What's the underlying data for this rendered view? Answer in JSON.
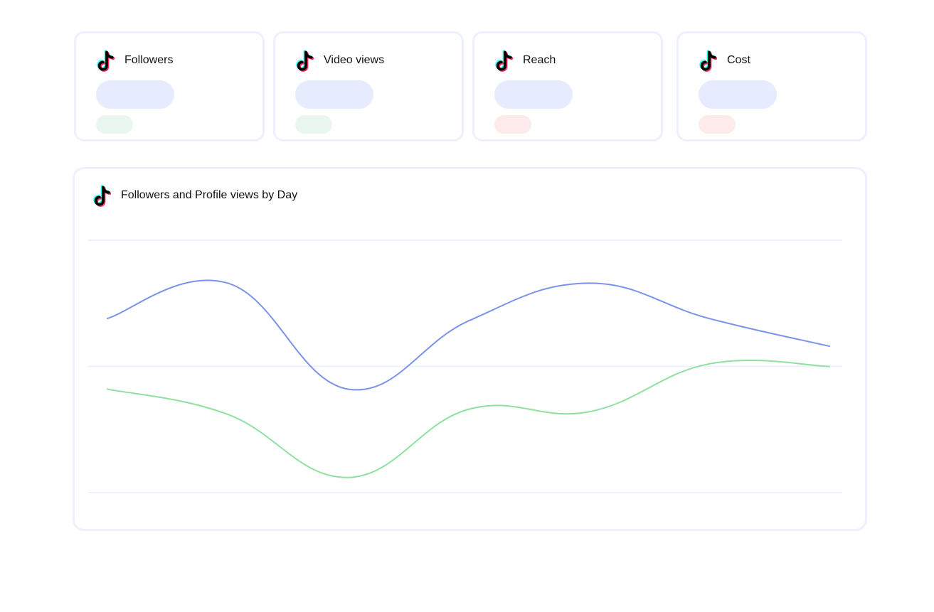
{
  "cards": [
    {
      "title": "Followers",
      "value_placeholder_color": "#e6ebfd",
      "delta_placeholder_color": "#eaf7ee",
      "delta_trend": "positive"
    },
    {
      "title": "Video views",
      "value_placeholder_color": "#e6ebfd",
      "delta_placeholder_color": "#eaf7ee",
      "delta_trend": "positive"
    },
    {
      "title": "Reach",
      "value_placeholder_color": "#e6ebfd",
      "delta_placeholder_color": "#fdeaea",
      "delta_trend": "negative"
    },
    {
      "title": "Cost",
      "value_placeholder_color": "#e6ebfd",
      "delta_placeholder_color": "#fdeaea",
      "delta_trend": "negative"
    }
  ],
  "icons": {
    "platform": "tiktok-icon"
  },
  "colors": {
    "card_border": "#edf0fd",
    "gridline": "#edf0fd",
    "tiktok_cyan": "#25f4ee",
    "tiktok_red": "#fe2c55",
    "tiktok_black": "#000000"
  },
  "chart_data": {
    "type": "line",
    "title": "Followers and Profile views by Day",
    "xlabel": "",
    "ylabel": "",
    "x": [
      1,
      2,
      3,
      4,
      5,
      6,
      7
    ],
    "ylim": [
      0,
      100
    ],
    "yticks": [
      0,
      50,
      100
    ],
    "grid": true,
    "legend": "none",
    "smooth": true,
    "series": [
      {
        "color": "#7b93e8",
        "values": [
          69,
          83,
          41,
          68,
          83,
          69,
          58
        ]
      },
      {
        "color": "#8fe0a1",
        "values": [
          41,
          31,
          6,
          33,
          32,
          51,
          50
        ]
      }
    ]
  }
}
